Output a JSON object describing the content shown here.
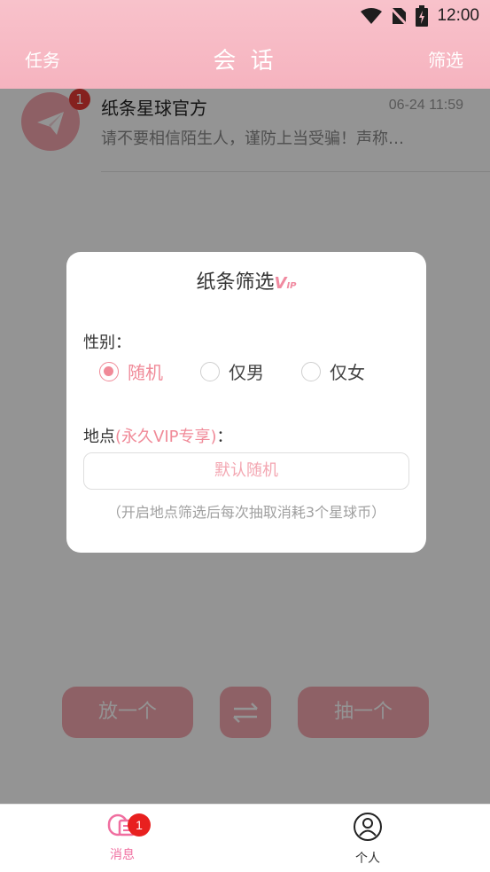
{
  "status": {
    "time": "12:00",
    "icons": [
      "wifi-icon",
      "no-sim-icon",
      "battery-charging-icon"
    ]
  },
  "header": {
    "left": "任务",
    "title": "会 话",
    "right": "筛选"
  },
  "conversation": {
    "avatar_icon": "paper-plane-icon",
    "badge": "1",
    "name": "纸条星球官方",
    "time": "06-24 11:59",
    "message": "请不要相信陌生人，谨防上当受骗！声称…"
  },
  "actions": {
    "put": "放一个",
    "swap_icon": "swap-arrows-icon",
    "draw": "抽一个"
  },
  "dialog": {
    "title": "纸条筛选",
    "vip_mark": "V",
    "vip_mark_small": "IP",
    "gender_label": "性别：",
    "gender_options": [
      "随机",
      "仅男",
      "仅女"
    ],
    "gender_selected": "随机",
    "location_label": "地点",
    "location_vip": "(永久VIP专享)",
    "location_colon": "：",
    "location_value": "默认随机",
    "note": "（开启地点筛选后每次抽取消耗3个星球币）"
  },
  "tabs": [
    {
      "label": "消息",
      "icon": "message-icon",
      "badge": "1",
      "active": true
    },
    {
      "label": "个人",
      "icon": "user-icon",
      "active": false
    }
  ],
  "colors": {
    "brand_pink": "#f6b3bf",
    "accent": "#f08a98",
    "badge_red": "#e8201f"
  }
}
